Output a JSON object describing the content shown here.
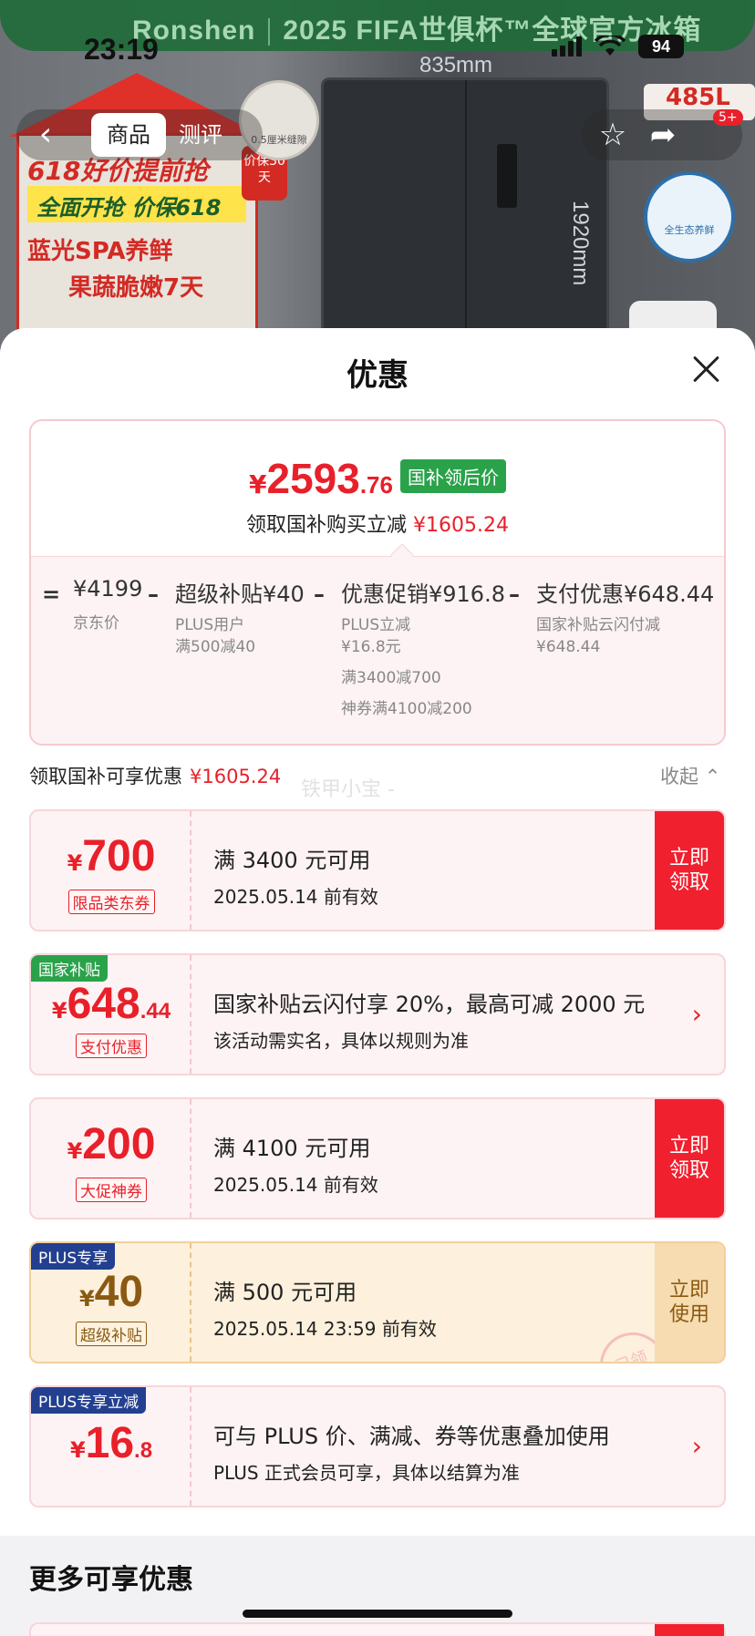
{
  "status_bar": {
    "time": "23:19",
    "battery": "94"
  },
  "background": {
    "banner_brand": "Ronshen",
    "banner_text": "2025 FIFA世俱杯™全球官方冰箱",
    "dim_width": "835mm",
    "dim_height": "1920mm",
    "promo_line1": "618好价提前抢",
    "promo_line2": "全面开抢 价保618",
    "promo_line3": "蓝光SPA养鲜",
    "promo_line4": "果蔬脆嫩7天",
    "promo_badge": "价保30天",
    "thumb_label": "0.5厘米缝隙",
    "eco_label": "全生态养鲜",
    "capacity": "485L"
  },
  "nav": {
    "tabs": [
      {
        "label": "商品"
      },
      {
        "label": "测评"
      }
    ],
    "more_badge": "5+"
  },
  "sheet": {
    "title": "优惠"
  },
  "price_card": {
    "yen": "¥",
    "price_int": "2593",
    "price_dec": ".76",
    "tag": "国补领后价",
    "subtitle": "领取国补购买立减",
    "subtitle_amount": "¥1605.24",
    "ops": [
      "=",
      "–",
      "–",
      "–"
    ],
    "items": [
      {
        "value": "¥4199",
        "notes": [
          "京东价"
        ]
      },
      {
        "value": "超级补贴¥40",
        "notes": [
          "PLUS用户",
          "满500减40"
        ]
      },
      {
        "value": "优惠促销¥916.8",
        "notes": [
          "PLUS立减",
          "¥16.8元",
          "满3400减700",
          "神券满4100减200"
        ]
      },
      {
        "value": "支付优惠¥648.44",
        "notes": [
          "国家补贴云闪付减",
          "¥648.44"
        ]
      }
    ]
  },
  "section": {
    "label": "领取国补可享优惠",
    "amount": "¥1605.24",
    "collapse": "收起",
    "watermark": "铁甲小宝 -"
  },
  "coupons": [
    {
      "yen": "¥",
      "amount": "700",
      "decimal": "",
      "type": "限品类东券",
      "ribbon": "",
      "title": "满 3400 元可用",
      "desc": "2025.05.14 前有效",
      "action": "立即 领取"
    },
    {
      "yen": "¥",
      "amount": "648",
      "decimal": ".44",
      "type": "支付优惠",
      "ribbon": "国家补贴",
      "title": "国家补贴云闪付享 20%，最高可减 2000 元",
      "desc": "该活动需实名，具体以规则为准",
      "action": ""
    },
    {
      "yen": "¥",
      "amount": "200",
      "decimal": "",
      "type": "大促神券",
      "ribbon": "",
      "title": "满 4100 元可用",
      "desc": "2025.05.14 前有效",
      "action": "立即 领取"
    },
    {
      "yen": "¥",
      "amount": "40",
      "decimal": "",
      "type": "超级补贴",
      "ribbon": "PLUS专享",
      "title": "满 500 元可用",
      "desc": "2025.05.14 23:59 前有效",
      "action": "立即 使用",
      "stamp": "已领"
    },
    {
      "yen": "¥",
      "amount": "16",
      "decimal": ".8",
      "type": "",
      "ribbon": "PLUS专享立减",
      "title": "可与 PLUS 价、满减、券等优惠叠加使用",
      "desc": "PLUS 正式会员可享，具体以结算为准",
      "action": ""
    }
  ],
  "more": {
    "title": "更多可享优惠"
  },
  "colors": {
    "accent_red": "#e8202a",
    "gov_green": "#2aa24a",
    "plus_blue": "#233f8f",
    "plus_gold": "#8a5a12"
  }
}
